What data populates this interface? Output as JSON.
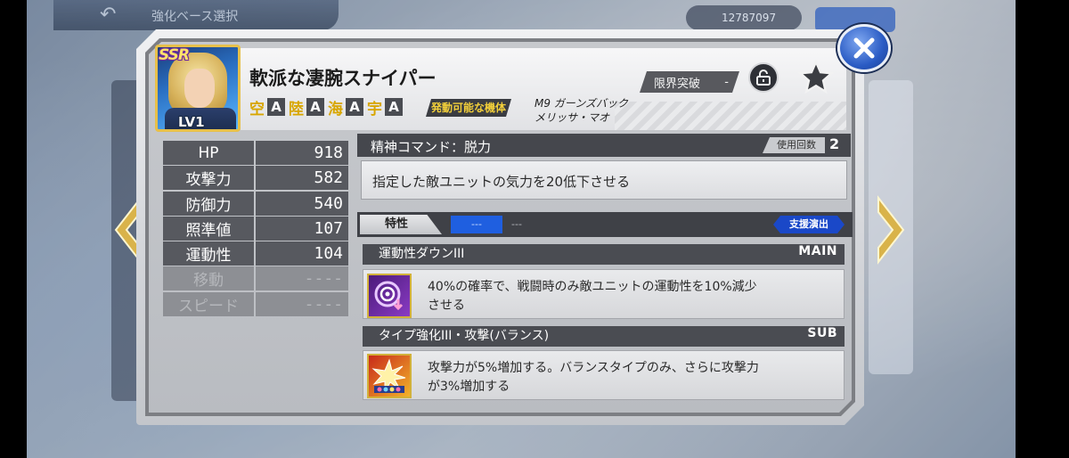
{
  "background": {
    "header_title": "強化ベース選択",
    "money": "12787097"
  },
  "card": {
    "rarity": "SSR",
    "level": "LV1",
    "name": "軟派な凄腕スナイパー",
    "terrain": [
      {
        "label": "空",
        "rank": "A"
      },
      {
        "label": "陸",
        "rank": "A"
      },
      {
        "label": "海",
        "rank": "A"
      },
      {
        "label": "宇",
        "rank": "A"
      }
    ],
    "deploy_label": "発動可能な機体",
    "machine_line1": "M9 ガーンズバック",
    "machine_line2": "メリッサ・マオ",
    "limit_break_label": "限界突破",
    "limit_break_value": "-"
  },
  "stats": [
    {
      "name": "HP",
      "value": "918"
    },
    {
      "name": "攻撃力",
      "value": "582"
    },
    {
      "name": "防御力",
      "value": "540"
    },
    {
      "name": "照準値",
      "value": "107"
    },
    {
      "name": "運動性",
      "value": "104"
    },
    {
      "name": "移動",
      "value": "----"
    },
    {
      "name": "スピード",
      "value": "----"
    }
  ],
  "spirit": {
    "title": "精神コマンド：脱力",
    "uses_label": "使用回数",
    "uses": "2",
    "description": "指定した敵ユニットの気力を20低下させる"
  },
  "traits": {
    "label": "特性",
    "tab_active": "---",
    "tab_other": "---",
    "support_label": "支援演出",
    "main": {
      "name": "運動性ダウンIII",
      "tag": "MAIN",
      "text_line1": "40%の確率で、戦闘時のみ敵ユニットの運動性を10%減少",
      "text_line2": "させる"
    },
    "sub": {
      "name": "タイプ強化III・攻撃(バランス)",
      "tag": "SUB",
      "text_line1": "攻撃力が5%増加する。バランスタイプのみ、さらに攻撃力",
      "text_line2": "が3%増加する"
    }
  },
  "icons": {
    "close": "close-icon",
    "lock": "unlock-icon",
    "favorite": "star-icon",
    "prev": "chevron-left-icon",
    "next": "chevron-right-icon"
  },
  "colors": {
    "terrain_label": "#d8a600",
    "accent_blue": "#1f5fe0",
    "gold": "#e7c04a"
  }
}
